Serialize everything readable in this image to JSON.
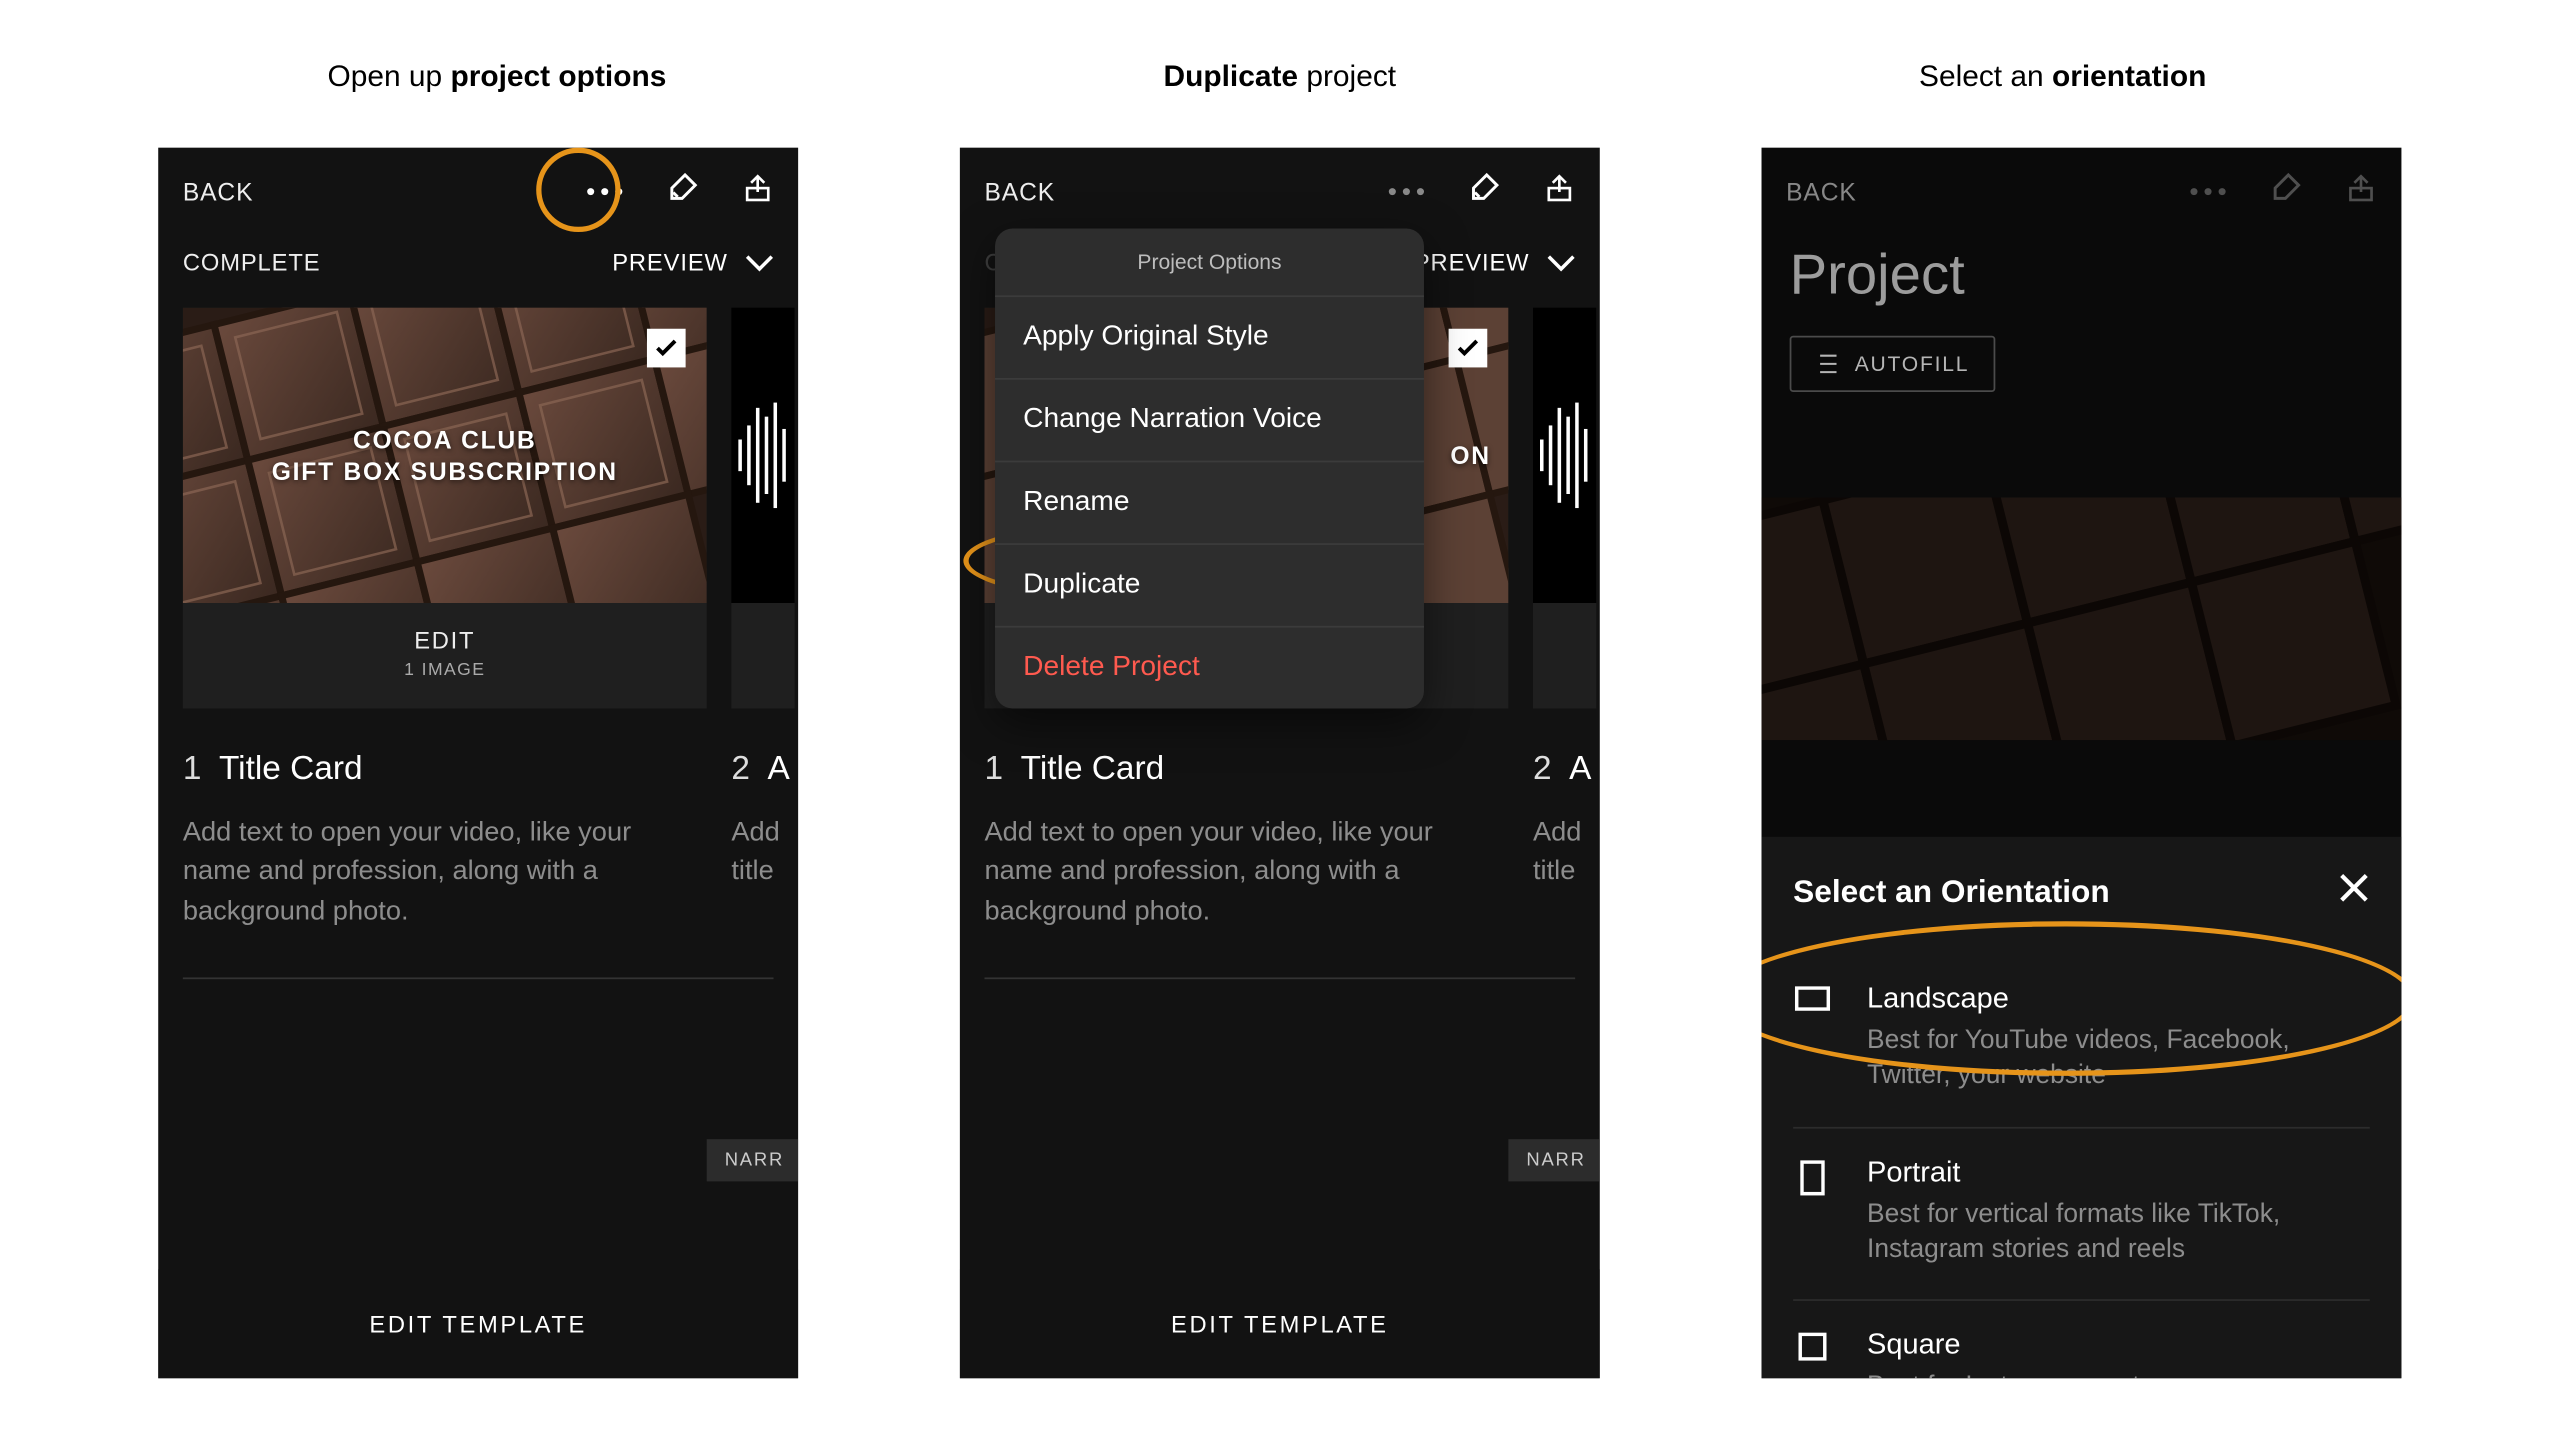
{
  "captions": {
    "c1a": "Open up ",
    "c1b": "project options",
    "c2a": "Duplicate ",
    "c2b": "project",
    "c3a": "Select an ",
    "c3b": "orientation"
  },
  "topbar": {
    "back": "BACK"
  },
  "subbar": {
    "complete": "COMPLETE",
    "preview": "PREVIEW"
  },
  "card": {
    "overlay_line1": "COCOA CLUB",
    "overlay_line2": "GIFT BOX SUBSCRIPTION",
    "overlay_line2_short": "ON",
    "edit": "EDIT",
    "count": "1 IMAGE"
  },
  "sections": {
    "s1_num": "1",
    "s1_title": "Title Card",
    "s1_body": "Add text to open your video, like your name and profession, along with a background photo.",
    "s2_num": "2",
    "s2_title": "A",
    "s2_body_a": "Add",
    "s2_body_b": "title"
  },
  "pills": {
    "narr": "NARR"
  },
  "bottom": {
    "edit_template": "EDIT TEMPLATE"
  },
  "popover": {
    "head": "Project Options",
    "apply": "Apply Original Style",
    "change": "Change Narration Voice",
    "rename": "Rename",
    "duplicate": "Duplicate",
    "delete": "Delete Project"
  },
  "phone3": {
    "title": "Project",
    "autofill": "AUTOFILL",
    "sheet_title": "Select an Orientation",
    "landscape_t": "Landscape",
    "landscape_d": "Best for YouTube videos, Facebook, Twitter, your website",
    "portrait_t": "Portrait",
    "portrait_d": "Best for vertical formats like TikTok, Instagram stories and reels",
    "square_t": "Square",
    "square_d": "Best for Instagram posts"
  }
}
